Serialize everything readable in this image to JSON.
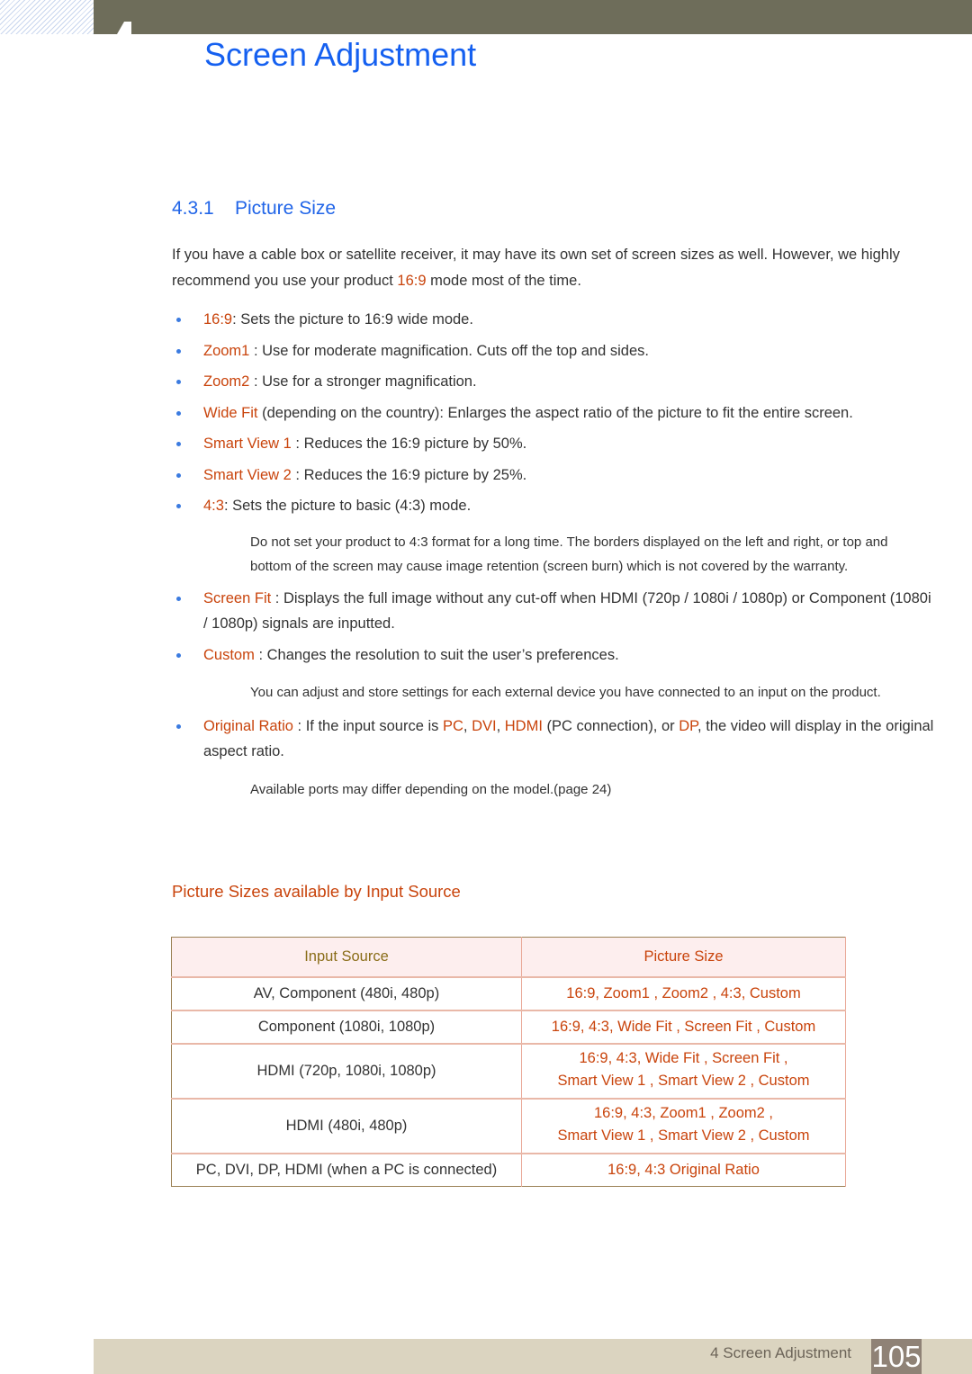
{
  "header": {
    "chapter_title": "Screen Adjustment"
  },
  "section": {
    "number": "4.3.1",
    "title": "Picture Size",
    "intro": {
      "before": "If you have a cable box or satellite receiver, it may have its own set of screen sizes as well. However, we highly recommend you use your product ",
      "highlight": "16:9",
      "after": " mode most of the time."
    },
    "items": [
      {
        "term": "16:9",
        "desc": ": Sets the picture to 16:9 wide mode."
      },
      {
        "term": "Zoom1",
        "desc": " : Use for moderate magnification. Cuts off the top and sides."
      },
      {
        "term": "Zoom2",
        "desc": " : Use for a stronger magnification."
      },
      {
        "term": "Wide Fit",
        "desc": "  (depending on the country): Enlarges the aspect ratio of the picture to fit the entire screen."
      },
      {
        "term": "Smart View 1",
        "desc": " : Reduces the 16:9 picture by 50%."
      },
      {
        "term": "Smart View 2",
        "desc": " : Reduces the 16:9 picture by 25%."
      },
      {
        "term": "4:3",
        "desc": ": Sets the picture to basic (4:3) mode."
      },
      {
        "term": "Screen Fit",
        "desc": " : Displays the full image without any cut-off when HDMI (720p / 1080i / 1080p) or Component (1080i / 1080p) signals are inputted."
      },
      {
        "term": "Custom",
        "desc": " : Changes the resolution to suit the user’s preferences."
      },
      {
        "term": "Original Ratio",
        "desc_1": " : If the input source is ",
        "pc": "PC",
        "c1": ", ",
        "dvi": "DVI",
        "c2": ", ",
        "hdmi": "HDMI",
        "desc_2": " (PC connection), or ",
        "dp": "DP",
        "desc_3": ", the video will display in the original aspect ratio."
      }
    ],
    "notes": {
      "four_three": "Do not set your product to 4:3 format for a long time. The borders displayed on the left and right, or top and bottom of the screen may cause image retention (screen burn) which is not covered by the warranty.",
      "custom": "You can adjust and store settings for each external device you have connected to an input on the product.",
      "ports": "Available ports may differ depending on the model.(page 24)"
    }
  },
  "table": {
    "title": "Picture Sizes available by Input Source",
    "headers": [
      "Input Source",
      "Picture Size"
    ],
    "rows": [
      {
        "input": "AV, Component (480i, 480p)",
        "line1": "16:9, Zoom1 , Zoom2 , 4:3, Custom",
        "line2": ""
      },
      {
        "input": "Component (1080i, 1080p)",
        "line1": "16:9, 4:3, Wide Fit , Screen Fit , Custom",
        "line2": ""
      },
      {
        "input": "HDMI (720p, 1080i, 1080p)",
        "line1": "16:9, 4:3, Wide Fit , Screen Fit ,",
        "line2": "Smart View 1 , Smart View 2 , Custom"
      },
      {
        "input": "HDMI (480i, 480p)",
        "line1": "16:9, 4:3, Zoom1 , Zoom2 ,",
        "line2": "Smart View 1 , Smart View 2 , Custom"
      },
      {
        "input": "PC, DVI, DP, HDMI (when a PC is connected)",
        "line1": "16:9, 4:3 Original Ratio",
        "line2": ""
      }
    ]
  },
  "footer": {
    "label": "4 Screen Adjustment",
    "page": "105"
  }
}
